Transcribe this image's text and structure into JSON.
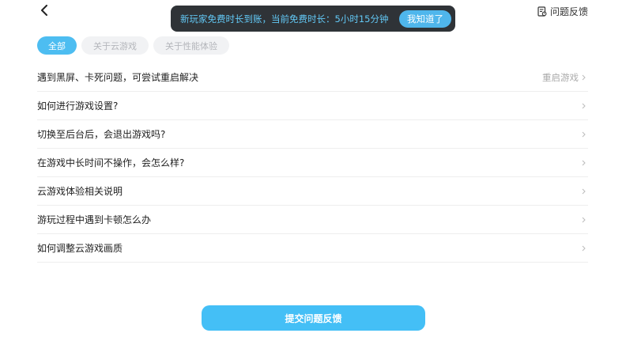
{
  "header": {
    "feedback_label": "问题反馈"
  },
  "toast": {
    "message": "新玩家免费时长到账，当前免费时长：5小时15分钟",
    "confirm_label": "我知道了"
  },
  "tabs": [
    {
      "label": "全部",
      "active": true
    },
    {
      "label": "关于云游戏",
      "active": false
    },
    {
      "label": "关于性能体验",
      "active": false
    }
  ],
  "faq_items": [
    {
      "label": "遇到黑屏、卡死问题，可尝试重启解决",
      "action": "重启游戏"
    },
    {
      "label": "如何进行游戏设置?",
      "action": ""
    },
    {
      "label": "切换至后台后，会退出游戏吗?",
      "action": ""
    },
    {
      "label": "在游戏中长时间不操作，会怎么样?",
      "action": ""
    },
    {
      "label": "云游戏体验相关说明",
      "action": ""
    },
    {
      "label": "游玩过程中遇到卡顿怎么办",
      "action": ""
    },
    {
      "label": "如何调整云游戏画质",
      "action": ""
    }
  ],
  "submit_label": "提交问题反馈",
  "icons": {
    "back": "chevron-left-icon",
    "feedback": "feedback-doc-icon",
    "row": "chevron-right-icon"
  },
  "colors": {
    "accent": "#4dbdf1",
    "toast_bg": "#2f3337",
    "toast_text": "#62c8f5",
    "tab_inactive_bg": "#f1f2f4",
    "tab_inactive_text": "#b4b6bb"
  }
}
